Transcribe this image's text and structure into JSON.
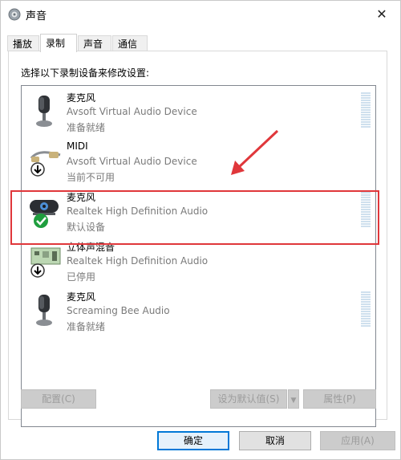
{
  "window": {
    "title": "声音"
  },
  "tabs": [
    {
      "label": "播放"
    },
    {
      "label": "录制"
    },
    {
      "label": "声音"
    },
    {
      "label": "通信"
    }
  ],
  "panel": {
    "prompt": "选择以下录制设备来修改设置:"
  },
  "devices": [
    {
      "name": "麦克风",
      "description": "Avsoft Virtual Audio Device",
      "status": "准备就绪",
      "icon": "microphone-icon"
    },
    {
      "name": "MIDI",
      "description": "Avsoft Virtual Audio Device",
      "status": "当前不可用",
      "icon": "midi-cable-icon"
    },
    {
      "name": "麦克风",
      "description": "Realtek High Definition Audio",
      "status": "默认设备",
      "icon": "webcam-microphone-icon"
    },
    {
      "name": "立体声混音",
      "description": "Realtek High Definition Audio",
      "status": "已停用",
      "icon": "sound-card-icon"
    },
    {
      "name": "麦克风",
      "description": "Screaming Bee Audio",
      "status": "准备就绪",
      "icon": "microphone-icon"
    }
  ],
  "actions": {
    "configure": "配置(C)",
    "set_default": "设为默认值(S)",
    "properties": "属性(P)"
  },
  "footer": {
    "ok": "确定",
    "cancel": "取消",
    "apply": "应用(A)"
  },
  "colors": {
    "highlight": "#e0373b",
    "arrow": "#e0373b",
    "accent": "#0078d7"
  }
}
